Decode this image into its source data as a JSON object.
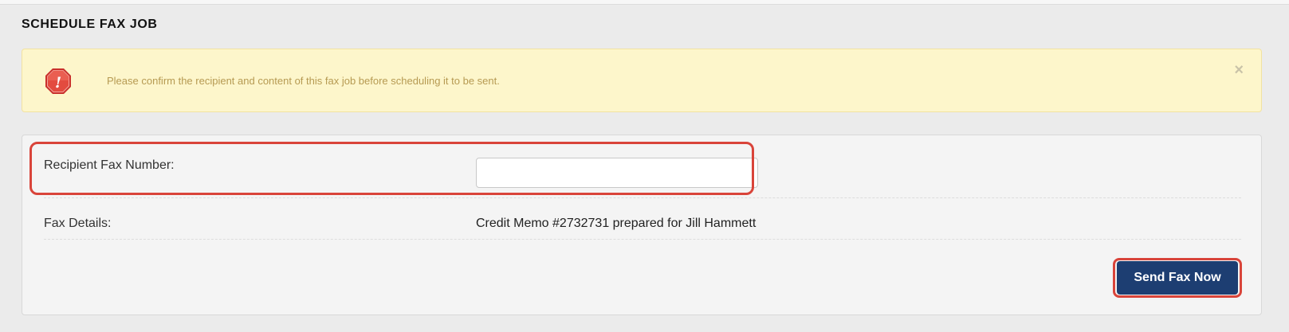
{
  "page": {
    "title": "SCHEDULE FAX JOB"
  },
  "alert": {
    "icon": "warning-octagon-icon",
    "message": "Please confirm the recipient and content of this fax job before scheduling it to be sent.",
    "close_glyph": "×",
    "background_color": "#fdf6cb",
    "text_color": "#b69a52"
  },
  "form": {
    "fax_number_label": "Recipient Fax Number:",
    "fax_number_value": "",
    "fax_number_placeholder": "",
    "details_label": "Fax Details:",
    "details_value": "Credit Memo #2732731 prepared for Jill Hammett"
  },
  "actions": {
    "send_label": "Send Fax Now",
    "send_color": "#1d3e72"
  },
  "highlight_color": "#d9443a"
}
